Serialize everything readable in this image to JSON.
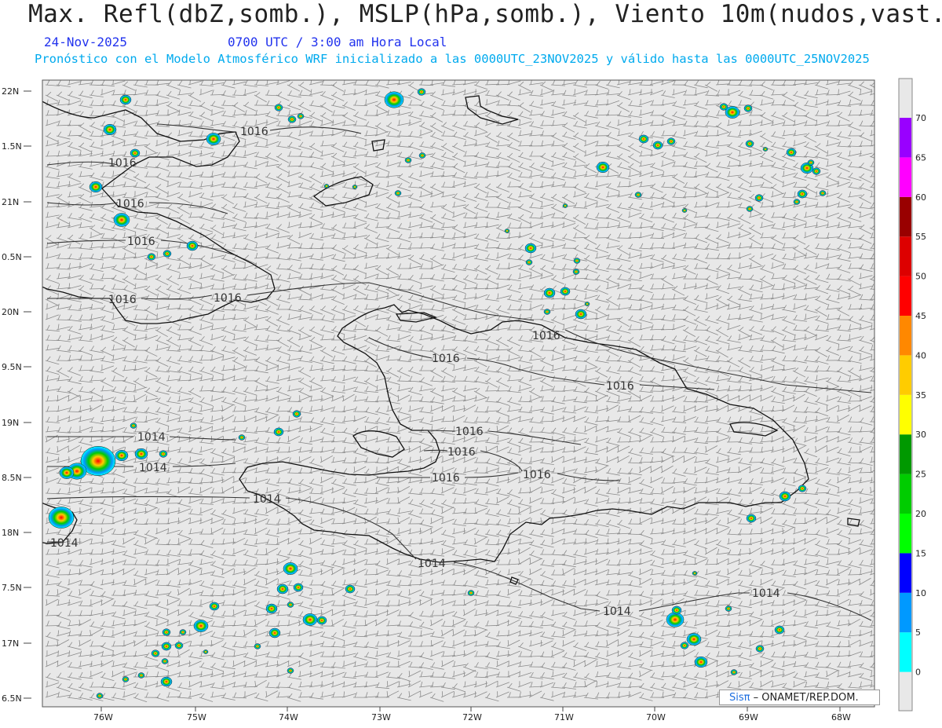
{
  "header": {
    "title": "Max. Refl(dbZ,somb.), MSLP(hPa,somb.), Viento 10m(nudos,vast.)",
    "date": "24-Nov-2025",
    "time": "0700 UTC / 3:00 am Hora Local",
    "description": "Pronóstico con el Modelo Atmosférico WRF inicializado a las 0000UTC_23NOV2025 y válido hasta las  0000UTC_25NOV2025"
  },
  "axes": {
    "lat_labels": [
      "22N",
      "1.5N",
      "21N",
      "0.5N",
      "20N",
      "9.5N",
      "19N",
      "8.5N",
      "18N",
      "7.5N",
      "17N",
      "6.5N"
    ],
    "lon_labels": [
      "76W",
      "75W",
      "74W",
      "73W",
      "72W",
      "71W",
      "70W",
      "69W",
      "68W"
    ]
  },
  "isobars": [
    "1016",
    "1016",
    "1016",
    "1016",
    "1016",
    "1016",
    "1016",
    "1016",
    "1016",
    "1016",
    "1016",
    "1016",
    "1014",
    "1014",
    "1014",
    "1014",
    "1014",
    "1014",
    "1014"
  ],
  "colorbar": {
    "labels": [
      "0",
      "5",
      "10",
      "15",
      "20",
      "25",
      "30",
      "35",
      "40",
      "45",
      "50",
      "55",
      "60",
      "65",
      "70"
    ],
    "colors": [
      "#00ffff",
      "#0099ff",
      "#0000ff",
      "#00ff00",
      "#00cc00",
      "#009900",
      "#ffff00",
      "#ffcc00",
      "#ff8800",
      "#ff0000",
      "#dd0000",
      "#990000",
      "#ff00ff",
      "#9900ff"
    ]
  },
  "credit": {
    "brand": "Sisπ",
    "text": "– ONAMET/REP.DOM."
  },
  "colors": {
    "background": "#e8e8e8",
    "barb": "#8a8a8a",
    "coast": "#111111",
    "title_blue": "#2233ee",
    "subtitle_cyan": "#00aaee"
  }
}
